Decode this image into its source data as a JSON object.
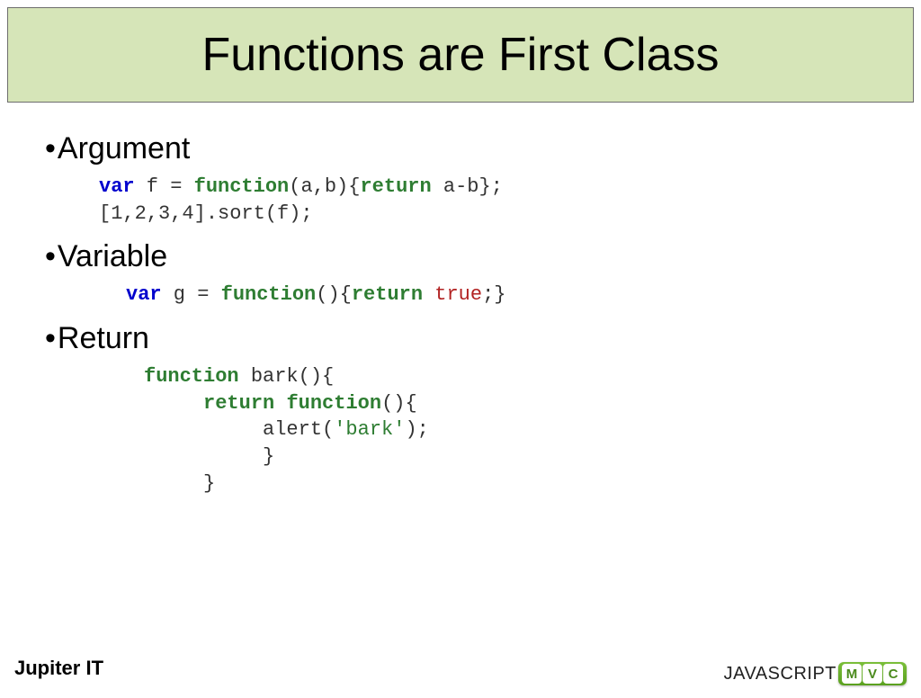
{
  "title": "Functions are First Class",
  "sections": [
    {
      "label": "Argument",
      "code_html": "<span class=\"kw-blue\">var</span> f = <span class=\"kw-green\">function</span>(a,b){<span class=\"kw-green\">return</span> a-b};\n[1,2,3,4].sort(f);"
    },
    {
      "label": "Variable",
      "code_html": "<span class=\"kw-blue\">var</span> g = <span class=\"kw-green\">function</span>(){<span class=\"kw-green\">return</span> <span class=\"literal\">true</span>;}"
    },
    {
      "label": "Return",
      "code_html": "<span class=\"kw-green\">function</span> bark(){\n     <span class=\"kw-green\">return</span> <span class=\"kw-green\">function</span>(){\n          alert(<span class=\"str\">'bark'</span>);\n          }\n     }"
    }
  ],
  "footer": {
    "left": "Jupiter IT",
    "brand_prefix": "JAVASCRIPT",
    "mvc": [
      "M",
      "V",
      "C"
    ]
  }
}
